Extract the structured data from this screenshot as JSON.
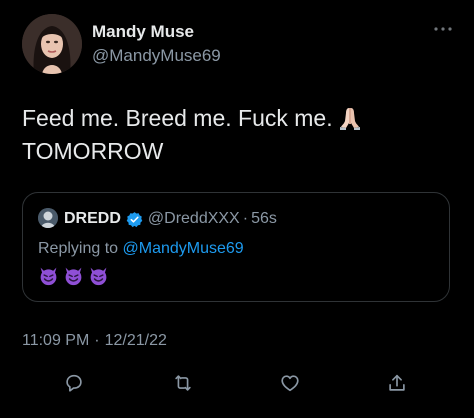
{
  "tweet": {
    "author": {
      "display_name": "Mandy Muse",
      "handle": "@MandyMuse69"
    },
    "text_line_1": "Feed me. Breed me. Fuck me.",
    "text_emoji": "folded-hands",
    "text_line_2": "TOMORROW",
    "timestamp_time": "11:09 PM",
    "timestamp_separator": "·",
    "timestamp_date": "12/21/22"
  },
  "quoted_tweet": {
    "display_name": "DREDD",
    "verified": true,
    "handle": "@DreddXXX",
    "separator": "·",
    "time_ago": "56s",
    "replying_prefix": "Replying to",
    "replying_to": "@MandyMuse69",
    "emojis": [
      "smiling-devil",
      "smiling-devil",
      "smiling-devil"
    ]
  },
  "actions": [
    "reply-icon",
    "retweet-icon",
    "like-icon",
    "share-icon"
  ],
  "colors": {
    "background": "#000000",
    "primary_text": "#e7e9ea",
    "secondary_text": "#8b98a5",
    "link": "#1d9bf0",
    "border": "#2f3336",
    "devil_purple": "#8f4fd6"
  }
}
